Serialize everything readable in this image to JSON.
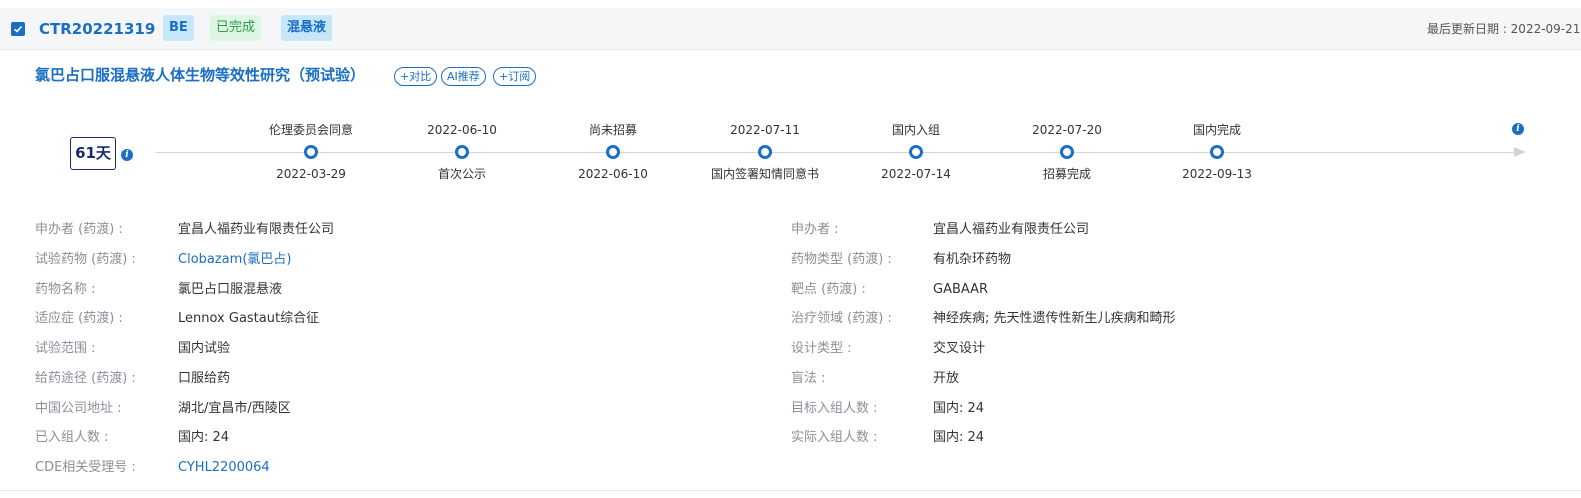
{
  "header": {
    "trial_id": "CTR20221319",
    "tags": [
      "BE",
      "已完成",
      "混悬液"
    ],
    "updated": "最后更新日期 : 2022-09-21"
  },
  "title": {
    "text": "氯巴占口服混悬液人体生物等效性研究（预试验）",
    "actions": [
      "+对比",
      "AI推荐",
      "+订阅"
    ]
  },
  "timeline": {
    "days": "61天",
    "top_labels": [
      "伦理委员会同意",
      "2022-06-10",
      "尚未招募",
      "2022-07-11",
      "国内入组",
      "2022-07-20",
      "国内完成"
    ],
    "bottom_labels": [
      "2022-03-29",
      "首次公示",
      "2022-06-10",
      "国内签署知情同意书",
      "2022-07-14",
      "招募完成",
      "2022-09-13"
    ]
  },
  "fields_left": [
    {
      "label": "申办者 (药渡) :",
      "value": "宜昌人福药业有限责任公司",
      "link": false
    },
    {
      "label": "试验药物 (药渡) :",
      "value": "Clobazam(氯巴占)",
      "link": true
    },
    {
      "label": "药物名称 :",
      "value": "氯巴占口服混悬液",
      "link": false
    },
    {
      "label": "适应症 (药渡) :",
      "value": "Lennox Gastaut综合征",
      "link": false
    },
    {
      "label": "试验范围 :",
      "value": "国内试验",
      "link": false
    },
    {
      "label": "给药途径 (药渡) :",
      "value": "口服给药",
      "link": false
    },
    {
      "label": "中国公司地址 :",
      "value": "湖北/宜昌市/西陵区",
      "link": false
    },
    {
      "label": "已入组人数 :",
      "value": "国内: 24",
      "link": false
    },
    {
      "label": "CDE相关受理号 :",
      "value": "CYHL2200064",
      "link": true
    }
  ],
  "fields_right": [
    {
      "label": "申办者 :",
      "value": "宜昌人福药业有限责任公司"
    },
    {
      "label": "药物类型 (药渡) :",
      "value": "有机杂环药物"
    },
    {
      "label": "靶点 (药渡) :",
      "value": "GABAAR"
    },
    {
      "label": "治疗领域 (药渡) :",
      "value": "神经疾病; 先天性遗传性新生儿疾病和畸形"
    },
    {
      "label": "设计类型 :",
      "value": "交叉设计"
    },
    {
      "label": "盲法 :",
      "value": "开放"
    },
    {
      "label": "目标入组人数 :",
      "value": "国内: 24"
    },
    {
      "label": "实际入组人数 :",
      "value": "国内: 24"
    }
  ]
}
